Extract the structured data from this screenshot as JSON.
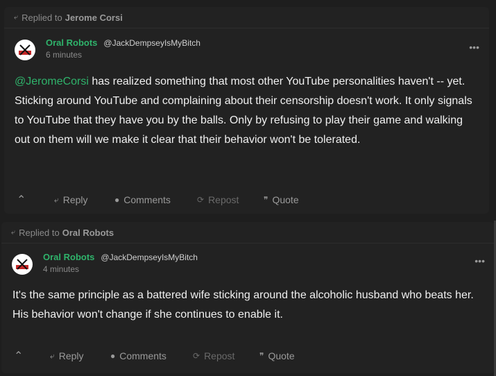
{
  "posts": [
    {
      "replied_prefix": "Replied to",
      "replied_to": "Jerome Corsi",
      "author": "Oral Robots",
      "handle": "@JackDempseyIsMyBitch",
      "time": "6 minutes",
      "mention": "@JeromeCorsi",
      "body": " has realized something that most other YouTube personalities haven't -- yet. Sticking around YouTube and complaining about their censorship doesn't work. It only signals to YouTube that they have you by the balls. Only by refusing to play their game and walking out on them will we make it clear that their behavior won't be tolerated.",
      "actions": {
        "reply": "Reply",
        "comments": "Comments",
        "repost": "Repost",
        "quote": "Quote"
      }
    },
    {
      "replied_prefix": "Replied to",
      "replied_to": "Oral Robots",
      "author": "Oral Robots",
      "handle": "@JackDempseyIsMyBitch",
      "time": "4 minutes",
      "body": "It's the same principle as a battered wife sticking around the alcoholic husband who beats her. His behavior won't change if she continues to enable it.",
      "actions": {
        "reply": "Reply",
        "comments": "Comments",
        "repost": "Repost",
        "quote": "Quote"
      }
    }
  ],
  "icons": {
    "reply_arrow": "reply-arrow-icon",
    "more": "more-options-icon",
    "upvote": "caret-up-icon",
    "comments": "comment-bubble-icon",
    "repost": "repost-icon",
    "quote": "quote-icon"
  },
  "colors": {
    "accent": "#2fb36b",
    "card": "#222222",
    "background": "#1e1e1e"
  }
}
